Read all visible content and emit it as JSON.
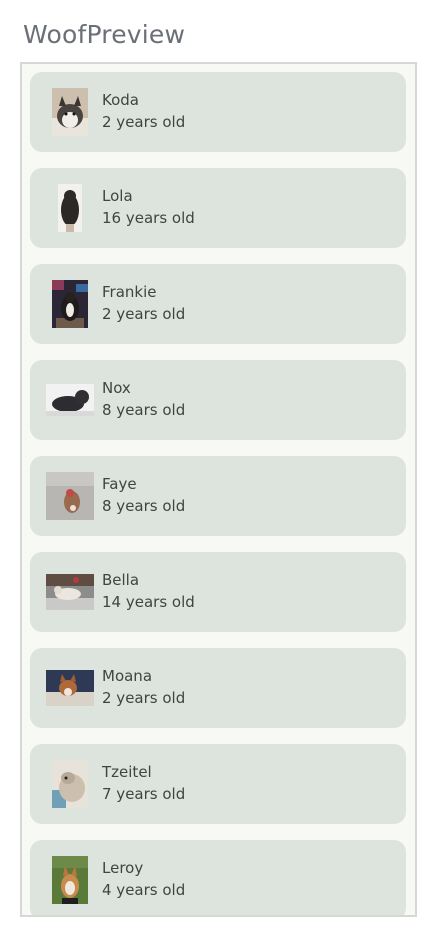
{
  "header": {
    "title": "WoofPreview"
  },
  "dogs": [
    {
      "name": "Koda",
      "age": "2 years old",
      "photo_icon": "husky-photo-icon"
    },
    {
      "name": "Lola",
      "age": "16 years old",
      "photo_icon": "black-dog-photo-icon"
    },
    {
      "name": "Frankie",
      "age": "2 years old",
      "photo_icon": "dog-on-rug-photo-icon"
    },
    {
      "name": "Nox",
      "age": "8 years old",
      "photo_icon": "black-puppy-photo-icon"
    },
    {
      "name": "Faye",
      "age": "8 years old",
      "photo_icon": "small-dog-photo-icon"
    },
    {
      "name": "Bella",
      "age": "14 years old",
      "photo_icon": "dog-on-blanket-photo-icon"
    },
    {
      "name": "Moana",
      "age": "2 years old",
      "photo_icon": "dog-on-couch-photo-icon"
    },
    {
      "name": "Tzeitel",
      "age": "7 years old",
      "photo_icon": "sleeping-dog-photo-icon"
    },
    {
      "name": "Leroy",
      "age": "4 years old",
      "photo_icon": "corgi-on-grass-photo-icon"
    }
  ],
  "colors": {
    "card_background": "#dde3dd",
    "list_background": "#f7faf4",
    "text": "#3f4541",
    "title": "#6b6f78"
  }
}
